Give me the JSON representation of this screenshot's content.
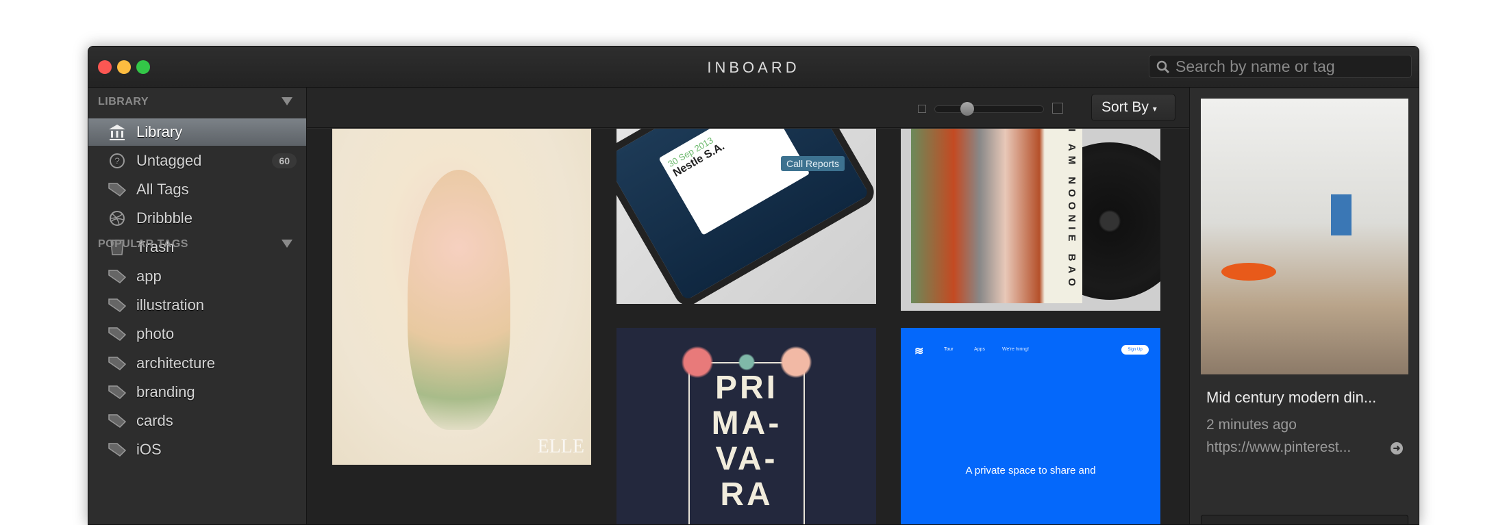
{
  "app": {
    "title": "INBOARD",
    "traffic_lights": {
      "close": "#fc5753",
      "minimize": "#fdbc40",
      "zoom": "#33c748"
    }
  },
  "search": {
    "placeholder": "Search by name or tag",
    "icon": "search-icon"
  },
  "sidebar": {
    "library_header": "LIBRARY",
    "library_items": [
      {
        "label": "Library",
        "icon": "bank-icon",
        "selected": true
      },
      {
        "label": "Untagged",
        "icon": "question-icon",
        "badge": "60"
      },
      {
        "label": "All Tags",
        "icon": "tag-icon"
      },
      {
        "label": "Dribbble",
        "icon": "dribbble-icon"
      },
      {
        "label": "Trash",
        "icon": "trash-icon"
      }
    ],
    "tags_header": "POPULAR TAGS",
    "tags": [
      "app",
      "illustration",
      "photo",
      "architecture",
      "branding",
      "cards",
      "iOS"
    ]
  },
  "toolbar": {
    "sort_label": "Sort By",
    "thumbnail_size_percent": 25
  },
  "grid": {
    "cards": [
      {
        "kind": "photo",
        "caption": "ELLE"
      },
      {
        "kind": "app",
        "texts": [
          "30 Sep 2013",
          "Nestle S.A.",
          "Call Reports"
        ]
      },
      {
        "kind": "album",
        "text": "I AM NOONIE BAO"
      },
      {
        "kind": "poster",
        "lines": [
          "PRI",
          "MA-",
          "VA-",
          "RA"
        ]
      },
      {
        "kind": "website",
        "nav": [
          "Tour",
          "Apps",
          "We're hiring!"
        ],
        "cta": "Sign Up",
        "headline": "A private space to share and"
      }
    ]
  },
  "detail": {
    "title": "Mid century modern din...",
    "time": "2 minutes ago",
    "url": "https://www.pinterest..."
  }
}
